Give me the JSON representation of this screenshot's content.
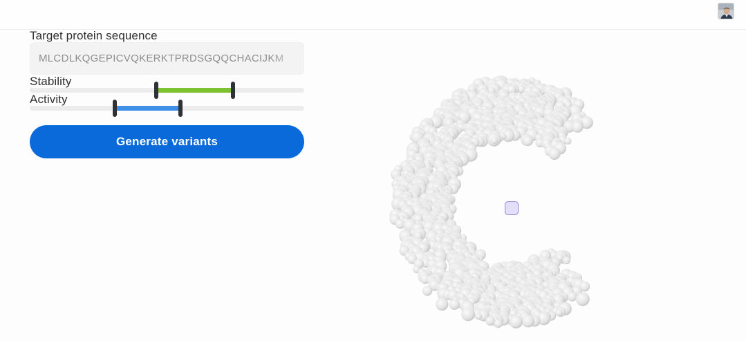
{
  "header": {
    "avatar_icon": "user-avatar-icon"
  },
  "form": {
    "sequence_label": "Target protein sequence",
    "sequence_value": "MLCDLKQGEPICVQKERKTPRDSGQQCHACIJKM",
    "stability_label": "Stability",
    "stability_range": {
      "min": 0.46,
      "max": 0.74
    },
    "activity_label": "Activity",
    "activity_range": {
      "min": 0.31,
      "max": 0.55
    },
    "generate_label": "Generate variants"
  },
  "colors": {
    "accent": "#0a6ad9",
    "stability": "#7bc22e",
    "activity": "#3f8fe6",
    "marker": "#8b86dc"
  },
  "viewer": {
    "icon": "protein-structure-icon"
  }
}
